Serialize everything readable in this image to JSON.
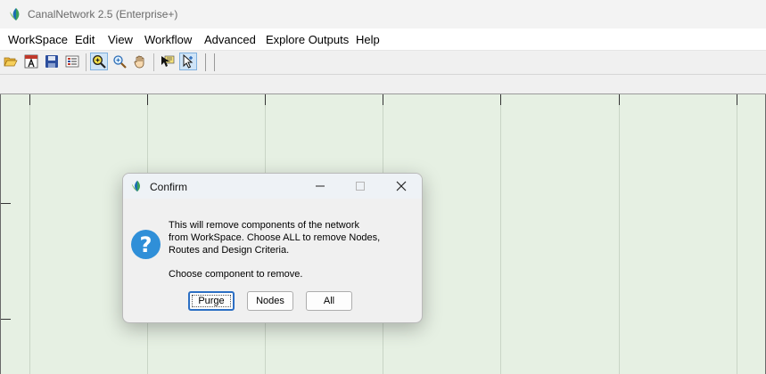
{
  "window": {
    "title": "CanalNetwork 2.5  (Enterprise+)"
  },
  "menubar": {
    "items": [
      {
        "label": "WorkSpace"
      },
      {
        "label": "Edit"
      },
      {
        "label": "View"
      },
      {
        "label": "Workflow"
      },
      {
        "label": "Advanced"
      },
      {
        "label": "Explore Outputs"
      },
      {
        "label": "Help"
      }
    ]
  },
  "toolbar": {
    "icons": [
      "folder-open-icon",
      "text-annotation-icon",
      "save-icon",
      "layers-icon",
      "zoom-window-icon",
      "zoom-icon",
      "pan-hand-icon",
      "edit-node-icon",
      "select-pointer-icon"
    ],
    "active": [
      "zoom-window-icon",
      "select-pointer-icon"
    ]
  },
  "dialog": {
    "title": "Confirm",
    "message_lines": [
      "This will remove components of the network",
      "from WorkSpace. Choose ALL to remove Nodes,",
      "Routes and Design Criteria."
    ],
    "prompt": "Choose component to remove.",
    "buttons": {
      "purge": "Purge",
      "nodes": "Nodes",
      "all": "All"
    },
    "default_button": "Purge",
    "icon": "question-icon"
  },
  "colors": {
    "canvas_bg": "#e6f0e3",
    "accent": "#2f8fd8",
    "focus_border": "#2c6fc4"
  }
}
